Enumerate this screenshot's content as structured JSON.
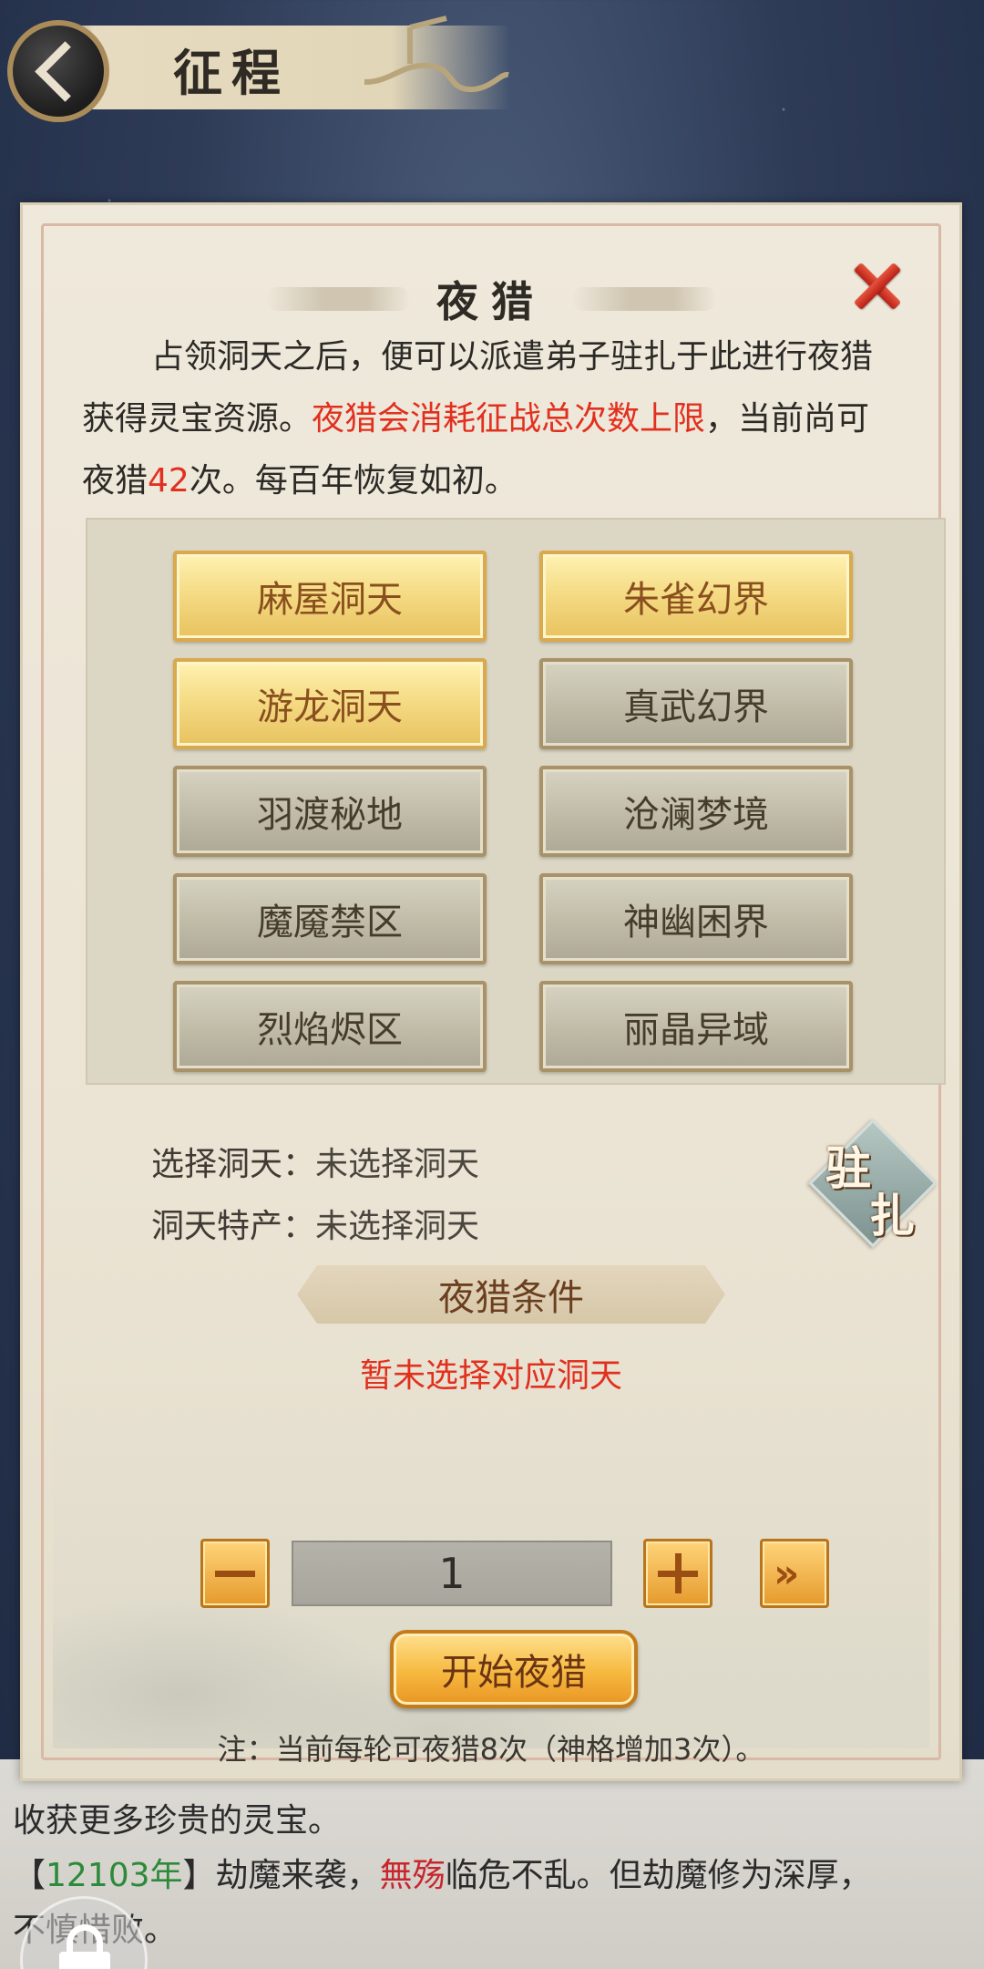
{
  "header": {
    "title": "征程"
  },
  "dialog": {
    "title": "夜猎",
    "intro": {
      "line1": "占领洞天之后，便可以派遣弟子驻扎于此进行夜猎",
      "line2_prefix": "获得灵宝资源。",
      "line2_red": "夜猎会消耗征战总次数上限",
      "line2_suffix": "，当前尚可",
      "line3_prefix": "夜猎",
      "line3_count": "42",
      "line3_suffix": "次。每百年恢复如初。"
    },
    "realms": [
      {
        "label": "麻屋洞天",
        "state": "gold"
      },
      {
        "label": "朱雀幻界",
        "state": "gold"
      },
      {
        "label": "游龙洞天",
        "state": "gold"
      },
      {
        "label": "真武幻界",
        "state": "gray"
      },
      {
        "label": "羽渡秘地",
        "state": "gray"
      },
      {
        "label": "沧澜梦境",
        "state": "gray"
      },
      {
        "label": "魔魇禁区",
        "state": "gray"
      },
      {
        "label": "神幽困界",
        "state": "gray"
      },
      {
        "label": "烈焰烬区",
        "state": "gray"
      },
      {
        "label": "丽晶异域",
        "state": "gray"
      }
    ],
    "selection": {
      "realm_label": "选择洞天：",
      "realm_value": "未选择洞天",
      "product_label": "洞天特产：",
      "product_value": "未选择洞天"
    },
    "station_button": {
      "char1": "驻",
      "char2": "扎"
    },
    "conditions": {
      "title": "夜猎条件",
      "note": "暂未选择对应洞天"
    },
    "quantity": "1",
    "start_button": "开始夜猎",
    "footnote": "注：当前每轮可夜猎8次（神格增加3次）。"
  },
  "log": {
    "line1_suffix": "收获更多珍贵的灵宝。",
    "entry2": {
      "open": "【",
      "year": "12103年",
      "close": "】劫魔来袭，",
      "name": "無殇",
      "rest": "临危不乱。但劫魔修为深厚，"
    },
    "line3": "不慎惜败。"
  },
  "colors": {
    "accent_red": "#e2301f",
    "year_green": "#2c8a3a",
    "gold_button": "#f5dc86",
    "gray_button": "#bfbba7"
  }
}
